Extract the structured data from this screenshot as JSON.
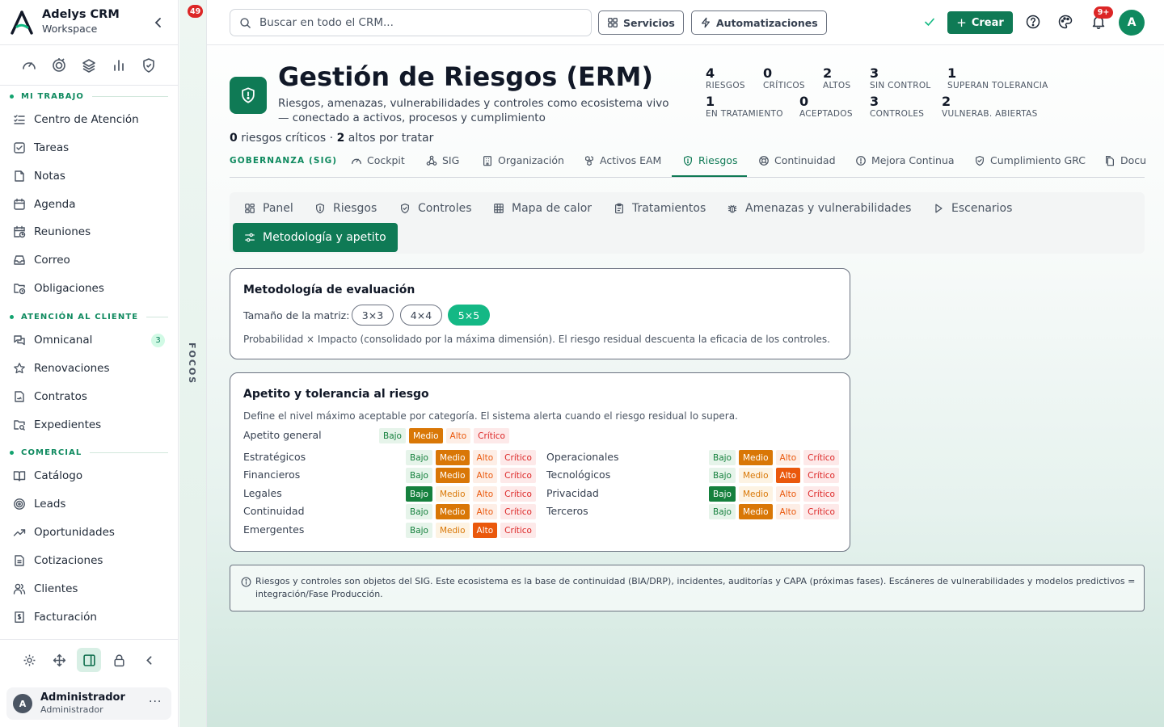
{
  "brand": {
    "name": "Adelys CRM",
    "workspace": "Workspace"
  },
  "sidebar": {
    "sections": [
      {
        "label": "MI TRABAJO",
        "items": [
          {
            "label": "Centro de Atención",
            "icon": "list-checks-icon"
          },
          {
            "label": "Tareas",
            "icon": "checkbox-icon"
          },
          {
            "label": "Notas",
            "icon": "note-icon"
          },
          {
            "label": "Agenda",
            "icon": "calendar-icon"
          },
          {
            "label": "Reuniones",
            "icon": "calendar-clock-icon"
          },
          {
            "label": "Correo",
            "icon": "inbox-icon"
          },
          {
            "label": "Obligaciones",
            "icon": "folder-clock-icon"
          }
        ]
      },
      {
        "label": "ATENCIÓN AL CLIENTE",
        "items": [
          {
            "label": "Omnicanal",
            "icon": "chat-icon",
            "badge": "3"
          },
          {
            "label": "Renovaciones",
            "icon": "star-icon"
          },
          {
            "label": "Contratos",
            "icon": "contract-icon"
          },
          {
            "label": "Expedientes",
            "icon": "folder-search-icon"
          }
        ]
      },
      {
        "label": "COMERCIAL",
        "items": [
          {
            "label": "Catálogo",
            "icon": "book-icon"
          },
          {
            "label": "Leads",
            "icon": "target-icon"
          },
          {
            "label": "Oportunidades",
            "icon": "trending-up-icon"
          },
          {
            "label": "Cotizaciones",
            "icon": "document-icon"
          },
          {
            "label": "Clientes",
            "icon": "users-icon"
          },
          {
            "label": "Facturación",
            "icon": "invoice-icon"
          }
        ]
      }
    ]
  },
  "user": {
    "initial": "A",
    "name": "Administrador",
    "role": "Administrador",
    "more": "···"
  },
  "focos": {
    "label": "FOCOS",
    "badge": "49"
  },
  "topbar": {
    "search_placeholder": "Buscar en todo el CRM...",
    "servicios": "Servicios",
    "automatizaciones": "Automatizaciones",
    "crear": "Crear",
    "notif_badge": "9+",
    "avatar": "A"
  },
  "header": {
    "title": "Gestión de Riesgos (ERM)",
    "description": "Riesgos, amenazas, vulnerabilidades y controles como ecosistema vivo — conectado a activos, procesos y cumplimiento",
    "summary_critical_count": "0",
    "summary_critical_text": " riesgos críticos · ",
    "summary_high_count": "2",
    "summary_high_text": " altos por tratar"
  },
  "stats": [
    {
      "value": "4",
      "label": "RIESGOS"
    },
    {
      "value": "0",
      "label": "CRÍTICOS"
    },
    {
      "value": "2",
      "label": "ALTOS"
    },
    {
      "value": "3",
      "label": "SIN CONTROL"
    },
    {
      "value": "1",
      "label": "SUPERAN TOLERANCIA"
    },
    {
      "value": "1",
      "label": "EN TRATAMIENTO"
    },
    {
      "value": "0",
      "label": "ACEPTADOS"
    },
    {
      "value": "3",
      "label": "CONTROLES"
    },
    {
      "value": "2",
      "label": "VULNERAB. ABIERTAS"
    }
  ],
  "module_tabs": {
    "label": "GOBERNANZA (SIG)",
    "items": [
      "Cockpit",
      "SIG",
      "Organización",
      "Activos EAM",
      "Riesgos",
      "Continuidad",
      "Mejora Continua",
      "Cumplimiento GRC",
      "Docu"
    ],
    "active": "Riesgos"
  },
  "sub_tabs": {
    "items": [
      "Panel",
      "Riesgos",
      "Controles",
      "Mapa de calor",
      "Tratamientos",
      "Amenazas y vulnerabilidades",
      "Escenarios",
      "Metodología y apetito"
    ],
    "active": "Metodología y apetito"
  },
  "methodology": {
    "title": "Metodología de evaluación",
    "size_label": "Tamaño de la matriz:",
    "sizes": [
      "3×3",
      "4×4",
      "5×5"
    ],
    "selected_size": "5×5",
    "description": "Probabilidad × Impacto (consolidado por la máxima dimensión). El riesgo residual descuenta la eficacia de los controles."
  },
  "appetite": {
    "title": "Apetito y tolerancia al riesgo",
    "description": "Define el nivel máximo aceptable por categoría. El sistema alerta cuando el riesgo residual lo supera.",
    "level_labels": [
      "Bajo",
      "Medio",
      "Alto",
      "Crítico"
    ],
    "general": {
      "label": "Apetito general",
      "selected": "Medio"
    },
    "categories": [
      {
        "label": "Estratégicos",
        "selected": "Medio"
      },
      {
        "label": "Operacionales",
        "selected": "Medio"
      },
      {
        "label": "Financieros",
        "selected": "Medio"
      },
      {
        "label": "Tecnológicos",
        "selected": "Alto"
      },
      {
        "label": "Legales",
        "selected": "Bajo"
      },
      {
        "label": "Privacidad",
        "selected": "Bajo"
      },
      {
        "label": "Continuidad",
        "selected": "Medio"
      },
      {
        "label": "Terceros",
        "selected": "Medio"
      },
      {
        "label": "Emergentes",
        "selected": "Alto"
      }
    ]
  },
  "note": "Riesgos y controles son objetos del SIG. Este ecosistema es la base de continuidad (BIA/DRP), incidentes, auditorías y CAPA (próximas fases). Escáneres de vulnerabilidades y modelos predictivos = integración/Fase Producción.",
  "colors": {
    "primary": "#0f7a55",
    "accent": "#14b885",
    "danger": "#dc2626"
  }
}
